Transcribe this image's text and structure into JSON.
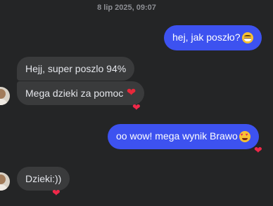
{
  "chat": {
    "timestamp": "8 lip 2025, 09:07",
    "messages": [
      {
        "direction": "outgoing",
        "text": "hej, jak poszło?",
        "emoji": "grinning-sweat-emoji",
        "reaction": ""
      },
      {
        "direction": "incoming",
        "text": "Hejj, super poszlo 94%",
        "emoji": "",
        "reaction": ""
      },
      {
        "direction": "incoming",
        "text": "Mega dzieki za pomoc",
        "emoji": "red-heart-emoji",
        "reaction": "❤"
      },
      {
        "direction": "outgoing",
        "text": "oo wow! mega wynik Brawo",
        "emoji": "heart-eyes-emoji",
        "reaction": "❤"
      },
      {
        "direction": "incoming",
        "text": "Dzieki:))",
        "emoji": "",
        "reaction": "❤"
      }
    ]
  },
  "colors": {
    "background": "#242526",
    "incoming_bubble": "#3a3b3c",
    "outgoing_bubble": "#3d52f0",
    "timestamp": "#8d8f94",
    "reaction_heart": "#f02849"
  }
}
